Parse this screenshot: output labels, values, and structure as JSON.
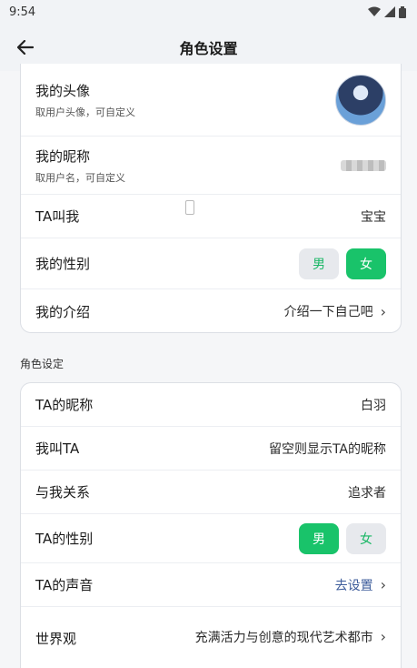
{
  "status": {
    "time": "9:54"
  },
  "appbar": {
    "title": "角色设置"
  },
  "my_profile": {
    "avatar": {
      "label": "我的头像",
      "sub": "取用户头像，可自定义"
    },
    "nickname": {
      "label": "我的昵称",
      "sub": "取用户名，可自定义"
    },
    "ta_calls_me": {
      "label": "TA叫我",
      "value": "宝宝"
    },
    "gender": {
      "label": "我的性别",
      "options": [
        "男",
        "女"
      ],
      "selected": "女"
    },
    "intro": {
      "label": "我的介绍",
      "value": "介绍一下自己吧"
    }
  },
  "role_section_title": "角色设定",
  "role": {
    "nickname": {
      "label": "TA的昵称",
      "value": "白羽"
    },
    "i_call": {
      "label": "我叫TA",
      "value": "留空则显示TA的昵称"
    },
    "relation": {
      "label": "与我关系",
      "value": "追求者"
    },
    "gender": {
      "label": "TA的性别",
      "options": [
        "男",
        "女"
      ],
      "selected": "男"
    },
    "voice": {
      "label": "TA的声音",
      "value": "去设置"
    },
    "worldview": {
      "label": "世界观",
      "value": "充满活力与创意的现代艺术都市"
    }
  },
  "colors": {
    "accent_green": "#19c36a",
    "link_blue": "#3b5b9a"
  }
}
